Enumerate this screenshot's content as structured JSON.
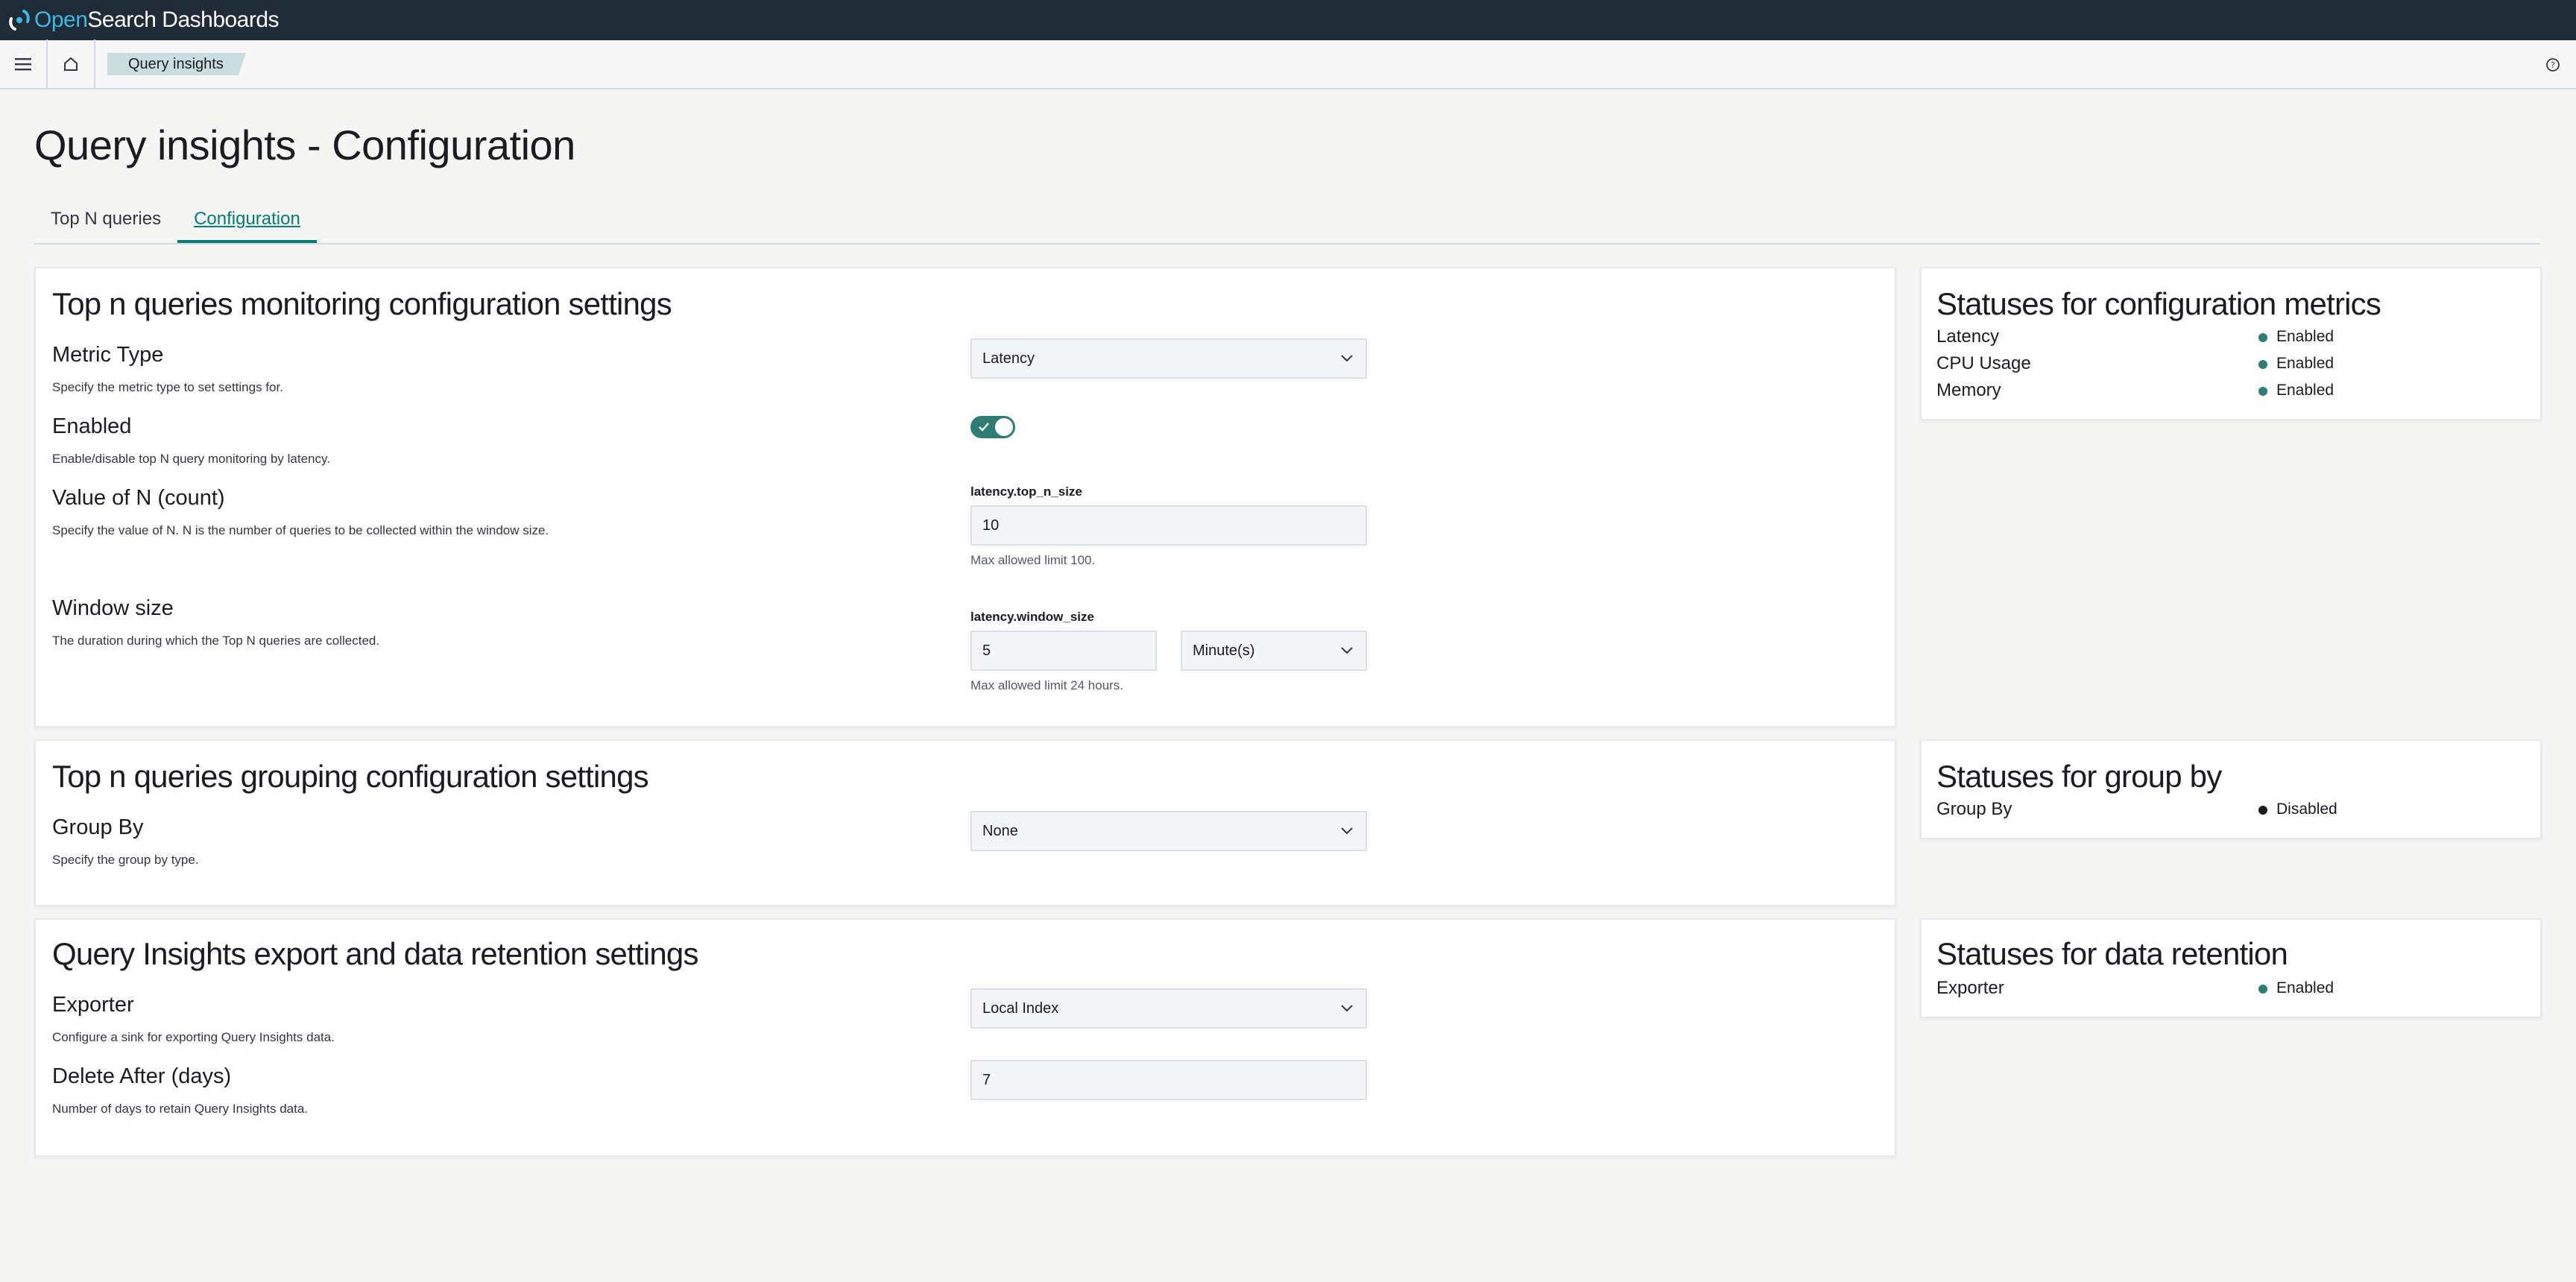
{
  "app": {
    "logo_open": "Open",
    "logo_rest": "Search Dashboards"
  },
  "breadcrumb": {
    "current": "Query insights"
  },
  "page": {
    "title": "Query insights - Configuration"
  },
  "tabs": [
    {
      "label": "Top N queries",
      "active": false
    },
    {
      "label": "Configuration",
      "active": true
    }
  ],
  "monitoring": {
    "title": "Top n queries monitoring configuration settings",
    "metric_type": {
      "label": "Metric Type",
      "help": "Specify the metric type to set settings for.",
      "value": "Latency"
    },
    "enabled": {
      "label": "Enabled",
      "help": "Enable/disable top N query monitoring by latency.",
      "value": true
    },
    "top_n": {
      "label": "Value of N (count)",
      "help": "Specify the value of N. N is the number of queries to be collected within the window size.",
      "field_label": "latency.top_n_size",
      "value": "10",
      "limit": "Max allowed limit 100."
    },
    "window": {
      "label": "Window size",
      "help": "The duration during which the Top N queries are collected.",
      "field_label": "latency.window_size",
      "value": "5",
      "unit": "Minute(s)",
      "limit": "Max allowed limit 24 hours."
    }
  },
  "grouping": {
    "title": "Top n queries grouping configuration settings",
    "group_by": {
      "label": "Group By",
      "help": "Specify the group by type.",
      "value": "None"
    }
  },
  "export": {
    "title": "Query Insights export and data retention settings",
    "exporter": {
      "label": "Exporter",
      "help": "Configure a sink for exporting Query Insights data.",
      "value": "Local Index"
    },
    "delete_after": {
      "label": "Delete After (days)",
      "help": "Number of days to retain Query Insights data.",
      "value": "7"
    }
  },
  "status_metrics": {
    "title": "Statuses for configuration metrics",
    "rows": [
      {
        "name": "Latency",
        "value": "Enabled"
      },
      {
        "name": "CPU Usage",
        "value": "Enabled"
      },
      {
        "name": "Memory",
        "value": "Enabled"
      }
    ]
  },
  "status_group": {
    "title": "Statuses for group by",
    "rows": [
      {
        "name": "Group By",
        "value": "Disabled"
      }
    ]
  },
  "status_retention": {
    "title": "Statuses for data retention",
    "rows": [
      {
        "name": "Exporter",
        "value": "Enabled"
      }
    ]
  },
  "colors": {
    "enabled": "#2f7c74",
    "disabled": "#1a1c21",
    "accent": "#017d73"
  },
  "icons": [
    "opensearch-logo-icon",
    "menu-icon",
    "home-icon",
    "help-icon",
    "chevron-down-icon",
    "check-icon"
  ]
}
